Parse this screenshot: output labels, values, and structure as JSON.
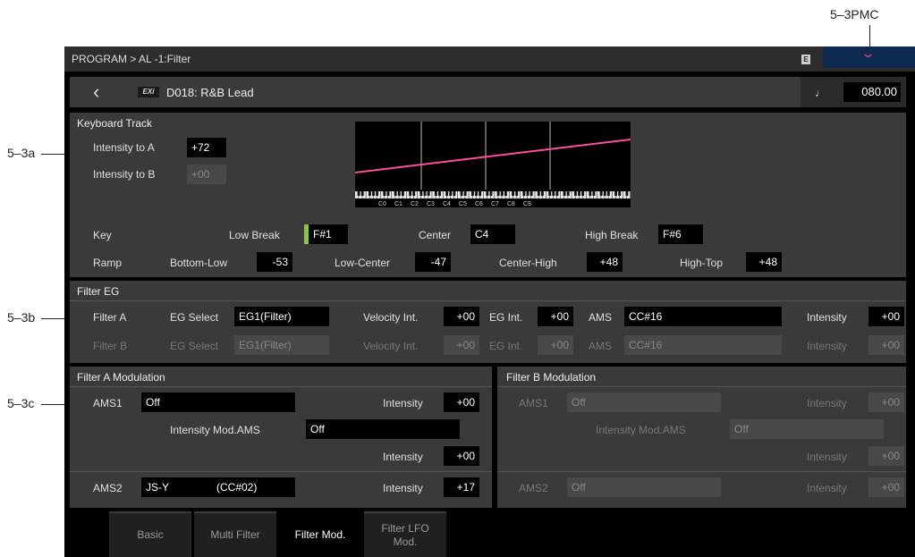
{
  "annotations": {
    "pmc": "5–3PMC",
    "a": "5–3a",
    "b": "5–3b",
    "c": "5–3c"
  },
  "header": {
    "breadcrumb": "PROGRAM > AL -1:Filter",
    "edit_badge": "E"
  },
  "program": {
    "engine_badge": "EXi",
    "name": "D018: R&B Lead",
    "tempo": "080.00"
  },
  "keyboard_track": {
    "title": "Keyboard Track",
    "intensity_a_label": "Intensity to A",
    "intensity_a_value": "+72",
    "intensity_b_label": "Intensity to B",
    "intensity_b_value": "+00",
    "graph_octaves": [
      "C0",
      "C1",
      "C2",
      "C3",
      "C4",
      "C5",
      "C6",
      "C7",
      "C8",
      "C9"
    ],
    "key_label": "Key",
    "low_break_label": "Low Break",
    "low_break_value": "F#1",
    "center_label": "Center",
    "center_value": "C4",
    "high_break_label": "High Break",
    "high_break_value": "F#6",
    "ramp_label": "Ramp",
    "bottom_low_label": "Bottom-Low",
    "bottom_low_value": "-53",
    "low_center_label": "Low-Center",
    "low_center_value": "-47",
    "center_high_label": "Center-High",
    "center_high_value": "+48",
    "high_top_label": "High-Top",
    "high_top_value": "+48",
    "line_color": "#ff4f9a"
  },
  "filter_eg": {
    "title": "Filter EG",
    "rows": [
      {
        "name": "Filter A",
        "eg_select_label": "EG Select",
        "eg_select": "EG1(Filter)",
        "velocity_label": "Velocity Int.",
        "velocity": "+00",
        "eg_int_label": "EG Int.",
        "eg_int": "+00",
        "ams_label": "AMS",
        "ams": "CC#16",
        "intensity_label": "Intensity",
        "intensity": "+00"
      },
      {
        "name": "Filter B",
        "eg_select_label": "EG Select",
        "eg_select": "EG1(Filter)",
        "velocity_label": "Velocity Int.",
        "velocity": "+00",
        "eg_int_label": "EG Int.",
        "eg_int": "+00",
        "ams_label": "AMS",
        "ams": "CC#16",
        "intensity_label": "Intensity",
        "intensity": "+00"
      }
    ]
  },
  "filter_a_mod": {
    "title": "Filter A Modulation",
    "ams1_label": "AMS1",
    "ams1_value": "Off",
    "intensity_label": "Intensity",
    "intensity1": "+00",
    "intensity_mod_ams_label": "Intensity Mod.AMS",
    "intensity_mod_ams_value": "Off",
    "intensity2": "+00",
    "ams2_label": "AMS2",
    "ams2_value": "JS-Y",
    "ams2_cc": "(CC#02)",
    "intensity3": "+17"
  },
  "filter_b_mod": {
    "title": "Filter B Modulation",
    "ams1_label": "AMS1",
    "ams1_value": "Off",
    "intensity_label": "Intensity",
    "intensity1": "+00",
    "intensity_mod_ams_label": "Intensity Mod.AMS",
    "intensity_mod_ams_value": "Off",
    "intensity2": "+00",
    "ams2_label": "AMS2",
    "ams2_value": "Off",
    "intensity3": "+00"
  },
  "tabs": [
    {
      "label": "Basic",
      "active": false
    },
    {
      "label": "Multi Filter",
      "active": false
    },
    {
      "label": "Filter Mod.",
      "active": true
    },
    {
      "label": "Filter LFO Mod.",
      "active": false
    }
  ]
}
